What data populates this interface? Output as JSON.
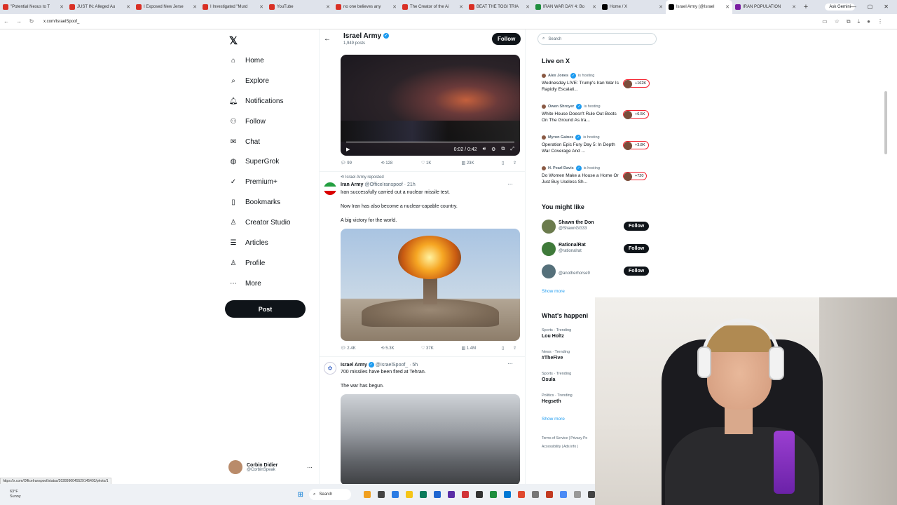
{
  "browser": {
    "tabs": [
      {
        "label": "\"Potential Nexus to T",
        "color": "#d93025"
      },
      {
        "label": "JUST IN: Alleged Au",
        "color": "#d93025"
      },
      {
        "label": "I Exposed New Jerse",
        "color": "#d93025"
      },
      {
        "label": "I Investigated \"Murd",
        "color": "#d93025"
      },
      {
        "label": "YouTube",
        "color": "#d93025"
      },
      {
        "label": "no one believes any",
        "color": "#d93025"
      },
      {
        "label": "The Creator of the Ai",
        "color": "#d93025"
      },
      {
        "label": "BEAT THE TOGI TRIA",
        "color": "#d93025"
      },
      {
        "label": "IRAN WAR DAY 4: Bo",
        "color": "#1e8e3e"
      },
      {
        "label": "Home / X",
        "color": "#000000"
      },
      {
        "label": "Israel Army (@Israel",
        "color": "#000000"
      },
      {
        "label": "IRAN POPULATION",
        "color": "#7b1fa2"
      }
    ],
    "ask_gemini": "Ask Gemini",
    "url": "x.com/IsraelSpoof_",
    "status_url": "https://x.com/OfficeIranspoof/status/2028990045529145402/photo/1"
  },
  "sidebar": {
    "items": [
      {
        "label": "Home",
        "icon": "home-icon",
        "glyph": "⌂"
      },
      {
        "label": "Explore",
        "icon": "search-icon",
        "glyph": "⌕"
      },
      {
        "label": "Notifications",
        "icon": "bell-icon",
        "glyph": "🔔︎"
      },
      {
        "label": "Follow",
        "icon": "person-add-icon",
        "glyph": "⚇"
      },
      {
        "label": "Chat",
        "icon": "mail-icon",
        "glyph": "✉"
      },
      {
        "label": "SuperGrok",
        "icon": "grok-icon",
        "glyph": "◍"
      },
      {
        "label": "Premium+",
        "icon": "premium-icon",
        "glyph": "✓"
      },
      {
        "label": "Bookmarks",
        "icon": "bookmark-icon",
        "glyph": "▯"
      },
      {
        "label": "Creator Studio",
        "icon": "creator-icon",
        "glyph": "♙"
      },
      {
        "label": "Articles",
        "icon": "article-icon",
        "glyph": "☰"
      },
      {
        "label": "Profile",
        "icon": "profile-icon",
        "glyph": "♙"
      },
      {
        "label": "More",
        "icon": "more-icon",
        "glyph": "⋯"
      }
    ],
    "post_label": "Post",
    "account": {
      "name": "Corbin Didier",
      "handle": "@CorbinSpeak"
    }
  },
  "profile": {
    "name": "Israel Army",
    "posts": "1,949 posts",
    "follow_label": "Follow"
  },
  "feed": {
    "video": {
      "time": "0:02 / 0:42"
    },
    "post0_actions": {
      "replies": "99",
      "reposts": "128",
      "likes": "1K",
      "views": "23K"
    },
    "post1": {
      "repost_line": "Israel Army reposted",
      "name": "Iran Army",
      "handle": "@OfficeIranspoof · 21h",
      "lines": [
        "Iran successfully carried out a nuclear missile test.",
        "Now Iran has also become a nuclear-capable country.",
        "A big victory for the world."
      ],
      "actions": {
        "replies": "2.4K",
        "reposts": "5.3K",
        "likes": "37K",
        "views": "1.4M"
      }
    },
    "post2": {
      "name": "Israel Army",
      "handle": "@IsraelSpoof_ · 5h",
      "lines": [
        "700 missiles have been fired at Tehran.",
        "The war has begun."
      ]
    }
  },
  "right": {
    "search_placeholder": "Search",
    "live_title": "Live on X",
    "live": [
      {
        "host": "Alex Jones",
        "suffix": "is hosting",
        "title": "Wednesday LIVE: Trump's Iran War Is Rapidly Escalati...",
        "count": "+162K"
      },
      {
        "host": "Owen Shroyer",
        "suffix": "is hosting",
        "title": "White House Doesn't Rule Out Boots On The Ground As Ira...",
        "count": "+6.5K"
      },
      {
        "host": "Myron Gaines",
        "suffix": "is hosting",
        "title": "Operation Epic Fury Day 5: In Depth War Coverage And ...",
        "count": "+3.8K"
      },
      {
        "host": "H. Pearl Davis",
        "suffix": "is hosting",
        "title": "Do Women Make a House a Home Or Just Buy Useless Sh...",
        "count": "+720"
      }
    ],
    "wtf_title": "You might like",
    "wtf": [
      {
        "name": "Shawn the Don",
        "handle": "@ShawnGG33",
        "button": "Follow"
      },
      {
        "name": "RationalRat",
        "handle": "@rationalrat",
        "button": "Follow"
      },
      {
        "name": "",
        "handle": "@anotherhorse9",
        "button": "Follow"
      }
    ],
    "show_more": "Show more",
    "happening_title": "What's happeni",
    "trends": [
      {
        "context": "Sports · Trending",
        "name": "Lou Holtz"
      },
      {
        "context": "News · Trending",
        "name": "#TheFive"
      },
      {
        "context": "Sports · Trending",
        "name": "Osula"
      },
      {
        "context": "Politics · Trending",
        "name": "Hegseth"
      }
    ],
    "show_more2": "Show more",
    "footer1": "Terms of Service  |  Privacy Po",
    "footer2": "Accessibility  |  Ads info  |"
  },
  "taskbar": {
    "temp": "63°F",
    "weather": "Sunny",
    "search": "Search"
  }
}
